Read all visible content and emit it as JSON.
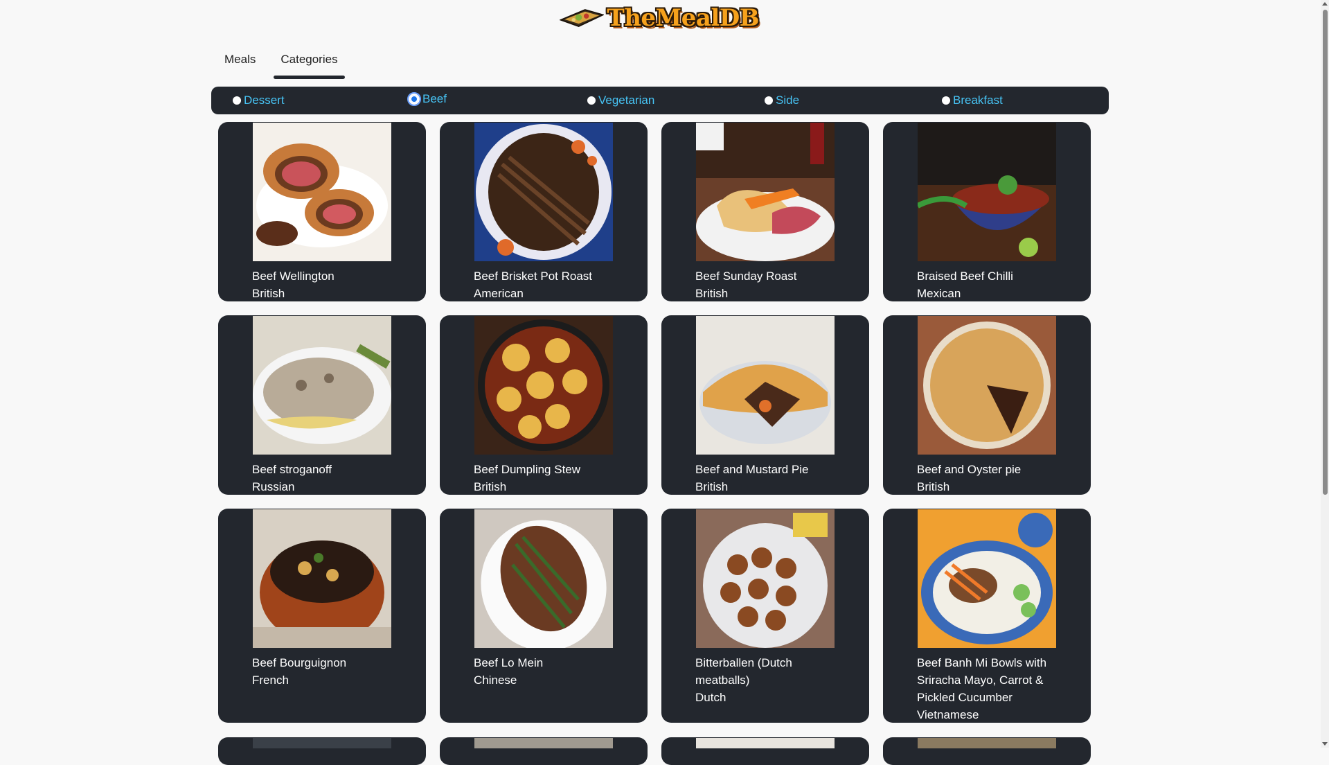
{
  "site": {
    "logo_text": "TheMealDB"
  },
  "tabs": [
    {
      "label": "Meals",
      "active": false
    },
    {
      "label": "Categories",
      "active": true
    }
  ],
  "categories": [
    {
      "label": "Dessert",
      "checked": false
    },
    {
      "label": "Beef",
      "checked": true
    },
    {
      "label": "Vegetarian",
      "checked": false
    },
    {
      "label": "Side",
      "checked": false
    },
    {
      "label": "Breakfast",
      "checked": false
    }
  ],
  "meals": [
    {
      "name": "Beef Wellington",
      "area": "British"
    },
    {
      "name": "Beef Brisket Pot Roast",
      "area": "American"
    },
    {
      "name": "Beef Sunday Roast",
      "area": "British"
    },
    {
      "name": "Braised Beef Chilli",
      "area": "Mexican"
    },
    {
      "name": "Beef stroganoff",
      "area": "Russian"
    },
    {
      "name": "Beef Dumpling Stew",
      "area": "British"
    },
    {
      "name": "Beef and Mustard Pie",
      "area": "British"
    },
    {
      "name": "Beef and Oyster pie",
      "area": "British"
    },
    {
      "name": "Beef Bourguignon",
      "area": "French"
    },
    {
      "name": "Beef Lo Mein",
      "area": "Chinese"
    },
    {
      "name": "Bitterballen (Dutch meatballs)",
      "area": "Dutch"
    },
    {
      "name": "Beef Banh Mi Bowls with Sriracha Mayo, Carrot & Pickled Cucumber",
      "area": "Vietnamese"
    }
  ],
  "colors": {
    "card_bg": "#23272e",
    "category_link": "#47c4f5",
    "page_bg": "#f8f8f8"
  }
}
